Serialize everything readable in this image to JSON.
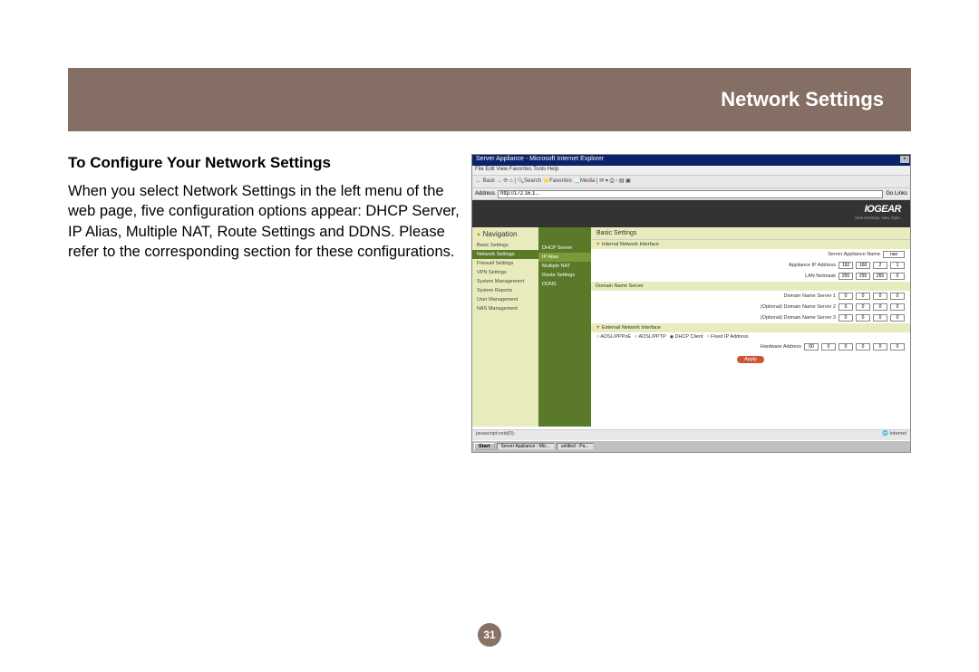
{
  "header": {
    "title": "Network Settings"
  },
  "section": {
    "title": "To Configure Your Network Settings",
    "body": "When you select Network Settings in the left menu of the web page, five configuration options appear: DHCP Server, IP Alias, Multiple NAT, Route Settings and DDNS. Please refer to the corresponding section for these configurations."
  },
  "page_number": "31",
  "screenshot": {
    "window_title": "Server Appliance - Microsoft Internet Explorer",
    "menu": "File   Edit   View   Favorites   Tools   Help",
    "toolbar": "← Back  →  ⟳  ⌂  | 🔍Search  ⭐Favorites  📃Media  | ✉ ▾  ⎙ ▫ ▤ ▣",
    "addr_label": "Address",
    "addr_value": "http://172.16.1...",
    "go_label": "Go   Links",
    "brand": "IOGEAR",
    "brand_tag": "New Desktop. New Style.",
    "nav_header": "Navigation",
    "nav": {
      "basic": "Basic Settings",
      "network": "Network Settings",
      "firewall": "Firewall Settings",
      "vpn": "VPN Settings",
      "sysmgmt": "System Management",
      "sysrep": "System Reports",
      "usermgmt": "User Management",
      "nas": "NAS Management"
    },
    "submenu": {
      "dhcp": "DHCP Server",
      "ipalias": "IP Alias",
      "mnat": "Multiple NAT",
      "route": "Route Settings",
      "ddns": "DDNS"
    },
    "panel": {
      "tab": "Basic Settings",
      "internal_hdr": "Internal Network Interface",
      "appliance_name_label": "Server Appliance Name",
      "appliance_name": "nas",
      "appliance_ip_label": "Appliance IP Address",
      "ip1": "192",
      "ip2": "168",
      "ip3": "2",
      "ip4": "1",
      "lan_netmask_label": "LAN Netmask",
      "nm1": "255",
      "nm2": "255",
      "nm3": "255",
      "nm4": "0",
      "dns_hdr": "Domain Name Server",
      "dns1_label": "Domain Name Server 1",
      "dns2_label": "(Optional) Domain Name Server 2",
      "dns3_label": "(Optional) Domain Name Server 3",
      "d0": "0",
      "ext_hdr": "External Network Interface",
      "r1": "ADSL/PPPoE",
      "r2": "ADSL/PPTP",
      "r3": "DHCP Client",
      "r4": "Fixed IP Address",
      "hw_label": "Hardware Address",
      "hw1": "00",
      "hw2": "0",
      "hw3": "0",
      "hw4": "0",
      "hw5": "0",
      "hw6": "0",
      "apply": "Apply"
    },
    "status_left": "javascript:void(0);",
    "status_right": "🌐 Internet",
    "taskbar": {
      "start": "Start",
      "t1": "Server Appliance - Mic...",
      "t2": "untitled - Pa..."
    }
  }
}
